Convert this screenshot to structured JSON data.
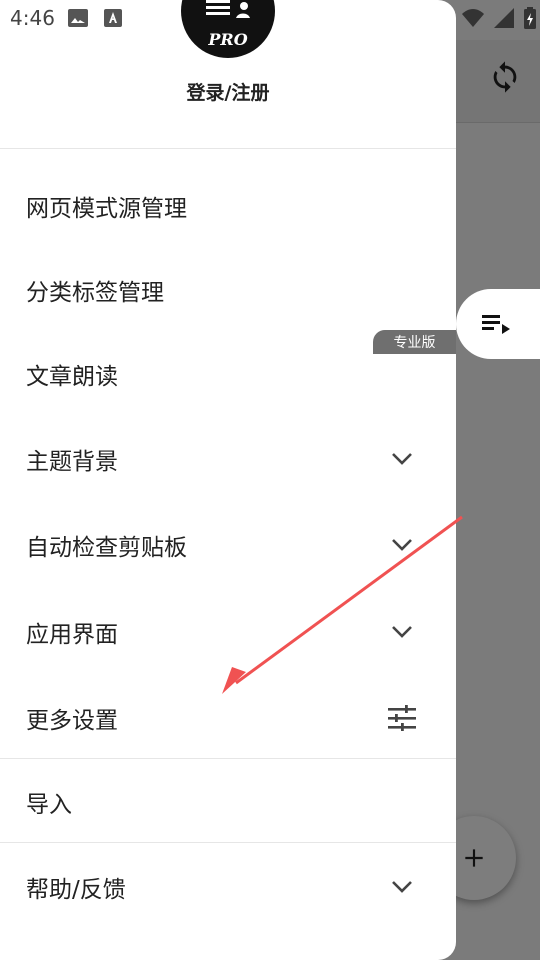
{
  "status_bar": {
    "time": "4:46",
    "left_icons": [
      "image-icon",
      "a-badge-icon"
    ],
    "right_icons": [
      "wifi-icon",
      "signal-icon",
      "battery-icon"
    ]
  },
  "drawer": {
    "avatar_badge": "PRO",
    "login_label": "登录/注册",
    "menu_items": [
      {
        "label": "网页模式源管理",
        "icon": ""
      },
      {
        "label": "分类标签管理",
        "icon": ""
      },
      {
        "label": "文章朗读",
        "icon": "",
        "tag": "专业版"
      },
      {
        "label": "主题背景",
        "icon": "chevron-down-icon"
      },
      {
        "label": "自动检查剪贴板",
        "icon": "chevron-down-icon"
      },
      {
        "label": "应用界面",
        "icon": "chevron-down-icon"
      },
      {
        "label": "更多设置",
        "icon": "sliders-icon"
      },
      {
        "label": "导入",
        "icon": ""
      },
      {
        "label": "帮助/反馈",
        "icon": "chevron-down-icon"
      }
    ]
  },
  "background": {
    "appbar_icon": "sync-icon",
    "fab_icon": "plus-icon",
    "float_tab_icon": "playlist-play-icon"
  },
  "colors": {
    "drawer_bg": "#ffffff",
    "scrim": "#7b7b7b",
    "annotation_arrow": "#f05252",
    "pro_tag_bg": "#6f6f6f"
  }
}
